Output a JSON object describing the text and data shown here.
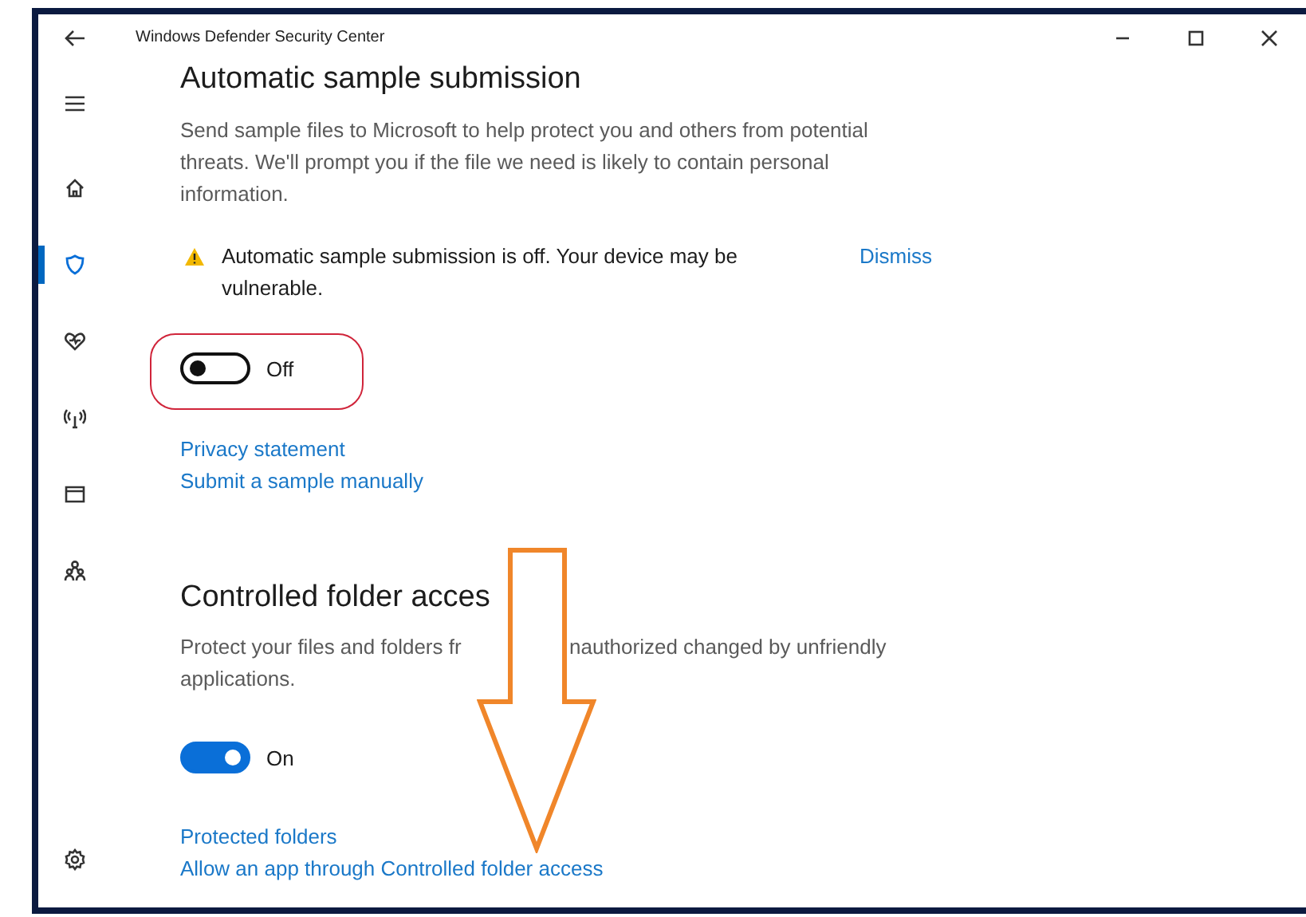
{
  "window": {
    "title": "Windows Defender Security Center"
  },
  "sidebar": {
    "items": [
      {
        "kind": "menu",
        "selected": false
      },
      {
        "kind": "home",
        "selected": false
      },
      {
        "kind": "shield",
        "selected": true
      },
      {
        "kind": "heart",
        "selected": false
      },
      {
        "kind": "network",
        "selected": false
      },
      {
        "kind": "app",
        "selected": false
      },
      {
        "kind": "family",
        "selected": false
      },
      {
        "kind": "settings",
        "selected": false
      }
    ]
  },
  "sections": [
    {
      "heading": "Automatic sample submission",
      "description": "Send sample files to Microsoft to help protect you and others from potential threats. We'll prompt you if the file we need is likely to contain personal information.",
      "notice": {
        "text": "Automatic sample submission is off. Your device may be vulnerable.",
        "action": "Dismiss"
      },
      "toggle": {
        "on": false,
        "label": "Off"
      },
      "links": [
        "Privacy statement",
        "Submit a sample manually"
      ]
    },
    {
      "heading": "Controlled folder acces",
      "description_lines": [
        [
          "Protect your files and folders fr",
          "nauthorized changed by unfriendly"
        ],
        [
          "applications."
        ]
      ],
      "toggle": {
        "on": true,
        "label": "On"
      },
      "links": [
        "Protected folders",
        "Allow an app through Controlled folder access"
      ]
    }
  ],
  "annotations": [
    {
      "kind": "ring",
      "color": "#d0243a"
    },
    {
      "kind": "down-arrow",
      "color": "#f0862a"
    }
  ]
}
